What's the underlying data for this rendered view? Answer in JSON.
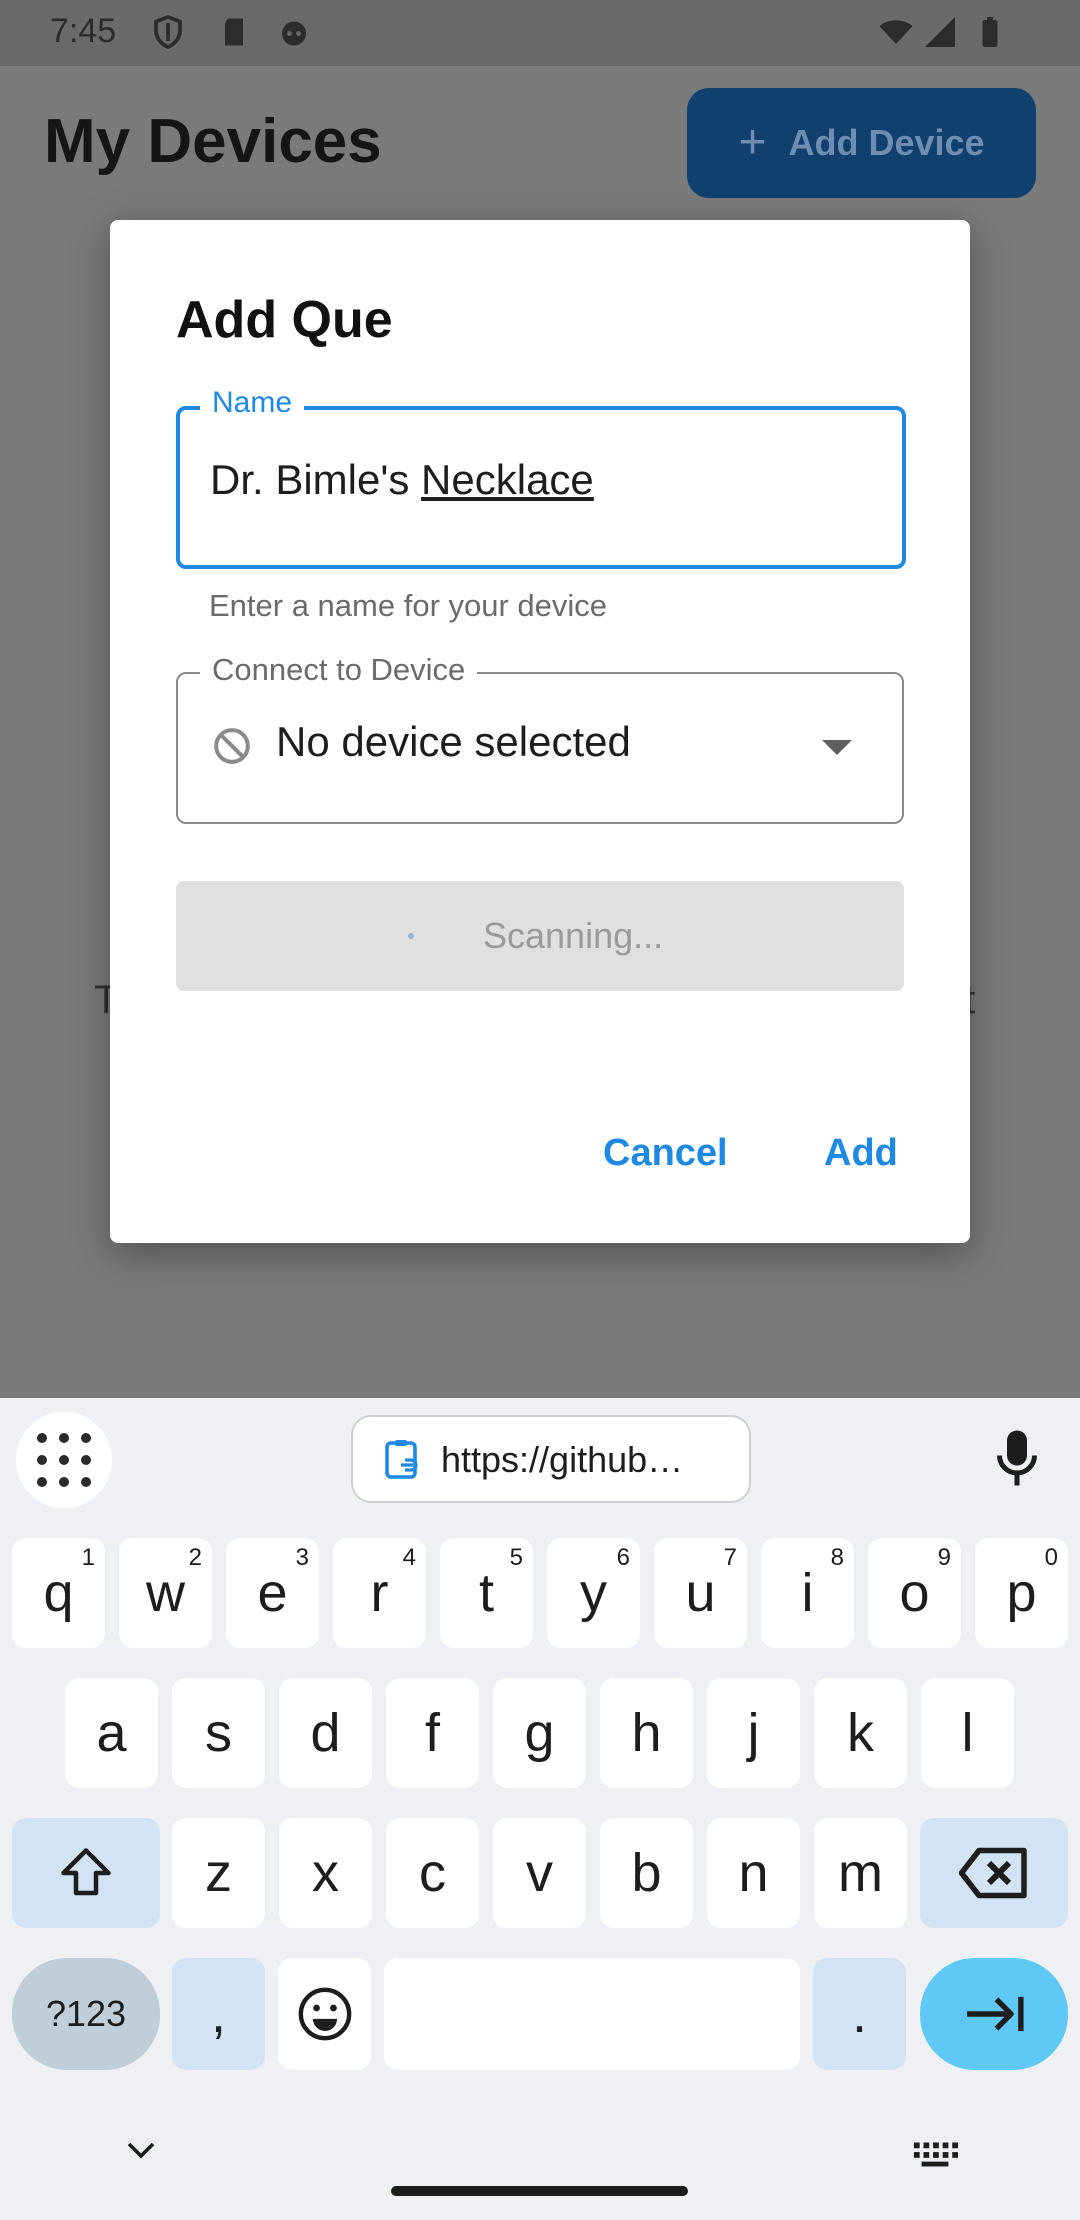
{
  "status_bar": {
    "time": "7:45"
  },
  "app": {
    "title": "My Devices",
    "add_device_label": "Add Device",
    "background_text_left": "T",
    "background_text_right": "t"
  },
  "dialog": {
    "title": "Add Que",
    "name_label": "Name",
    "name_value_prefix": "Dr. Bimle's ",
    "name_value_underlined": "Necklace",
    "name_helper": "Enter a name for your device",
    "device_label": "Connect to Device",
    "device_value": "No device selected",
    "scan_label": "Scanning...",
    "cancel_label": "Cancel",
    "add_label": "Add"
  },
  "keyboard": {
    "clipboard_text": "https://github…",
    "row1": [
      {
        "key": "q",
        "hint": "1"
      },
      {
        "key": "w",
        "hint": "2"
      },
      {
        "key": "e",
        "hint": "3"
      },
      {
        "key": "r",
        "hint": "4"
      },
      {
        "key": "t",
        "hint": "5"
      },
      {
        "key": "y",
        "hint": "6"
      },
      {
        "key": "u",
        "hint": "7"
      },
      {
        "key": "i",
        "hint": "8"
      },
      {
        "key": "o",
        "hint": "9"
      },
      {
        "key": "p",
        "hint": "0"
      }
    ],
    "row2": [
      "a",
      "s",
      "d",
      "f",
      "g",
      "h",
      "j",
      "k",
      "l"
    ],
    "row3": [
      "z",
      "x",
      "c",
      "v",
      "b",
      "n",
      "m"
    ],
    "symbols_label": "?123",
    "comma_label": ",",
    "period_label": "."
  },
  "colors": {
    "accent": "#1e88e5",
    "enter_key": "#60c8f6",
    "scrim": "#7a7a7a"
  }
}
